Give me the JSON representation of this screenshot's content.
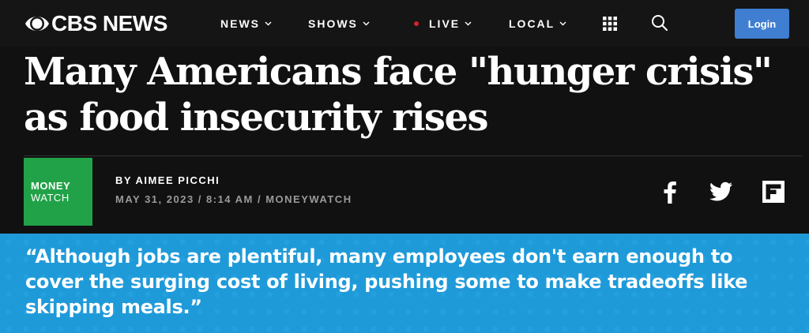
{
  "brand": {
    "logo_text": "CBS NEWS"
  },
  "nav": {
    "items": [
      {
        "label": "NEWS"
      },
      {
        "label": "SHOWS"
      },
      {
        "label": "LIVE"
      },
      {
        "label": "LOCAL"
      }
    ],
    "login_label": "Login"
  },
  "colors": {
    "accent_button": "#3f7ed0",
    "live_dot": "#d6232b",
    "moneywatch_green": "#21a248",
    "quote_banner": "#1f9ad9"
  },
  "icons": {
    "chevron": "chevron-down-icon",
    "grid": "grid-menu-icon",
    "search": "search-icon",
    "share": [
      "facebook-icon",
      "twitter-icon",
      "flipboard-icon"
    ]
  },
  "article": {
    "headline": "Many Americans face \"hunger crisis\" as food insecurity rises",
    "section_badge": {
      "line1": "MONEY",
      "line2": "WATCH"
    },
    "byline": "BY AIMEE PICCHI",
    "dateline": "MAY 31, 2023 / 8:14 AM / MONEYWATCH"
  },
  "quote": {
    "text": "“Although jobs are plentiful, many employees don't earn enough to cover the surging cost of living, pushing some to make tradeoffs like skipping meals.”"
  }
}
